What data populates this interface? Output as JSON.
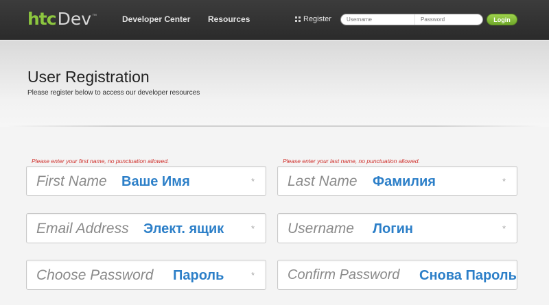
{
  "header": {
    "logo": {
      "htc": "htc",
      "dev": "Dev",
      "tm": "™"
    },
    "nav": [
      "Developer Center",
      "Resources"
    ],
    "register_label": "Register",
    "username_placeholder": "Username",
    "password_placeholder": "Password",
    "login_label": "Login"
  },
  "page": {
    "title": "User Registration",
    "subtitle": "Please register below to access our developer resources"
  },
  "form": {
    "errors": {
      "first_name": "Please enter your first name, no punctuation allowed.",
      "last_name": "Please enter your last name, no punctuation allowed."
    },
    "required_mark": "*",
    "fields": [
      {
        "placeholder": "First Name",
        "overlay": "Ваше Имя"
      },
      {
        "placeholder": "Last Name",
        "overlay": "Фамилия"
      },
      {
        "placeholder": "Email Address",
        "overlay": "Элект. ящик"
      },
      {
        "placeholder": "Username",
        "overlay": "Логин"
      },
      {
        "placeholder": "Choose Password",
        "overlay": "Пароль"
      },
      {
        "placeholder": "Confirm Password",
        "overlay": "Снова Пароль"
      }
    ]
  },
  "colors": {
    "brand_green": "#8cc63f",
    "overlay_blue": "#2c7fc8",
    "error_red": "#d0312d"
  }
}
